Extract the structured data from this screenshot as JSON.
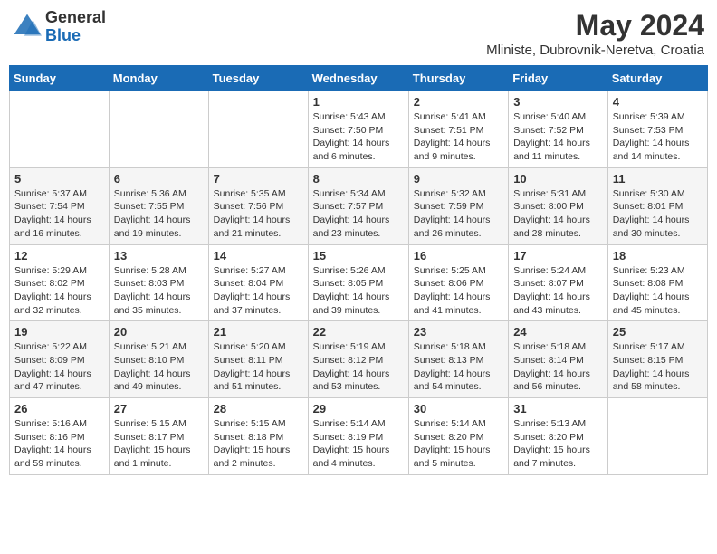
{
  "header": {
    "logo_general": "General",
    "logo_blue": "Blue",
    "month": "May 2024",
    "location": "Mliniste, Dubrovnik-Neretva, Croatia"
  },
  "days_of_week": [
    "Sunday",
    "Monday",
    "Tuesday",
    "Wednesday",
    "Thursday",
    "Friday",
    "Saturday"
  ],
  "weeks": [
    [
      {
        "day": "",
        "info": ""
      },
      {
        "day": "",
        "info": ""
      },
      {
        "day": "",
        "info": ""
      },
      {
        "day": "1",
        "info": "Sunrise: 5:43 AM\nSunset: 7:50 PM\nDaylight: 14 hours and 6 minutes."
      },
      {
        "day": "2",
        "info": "Sunrise: 5:41 AM\nSunset: 7:51 PM\nDaylight: 14 hours and 9 minutes."
      },
      {
        "day": "3",
        "info": "Sunrise: 5:40 AM\nSunset: 7:52 PM\nDaylight: 14 hours and 11 minutes."
      },
      {
        "day": "4",
        "info": "Sunrise: 5:39 AM\nSunset: 7:53 PM\nDaylight: 14 hours and 14 minutes."
      }
    ],
    [
      {
        "day": "5",
        "info": "Sunrise: 5:37 AM\nSunset: 7:54 PM\nDaylight: 14 hours and 16 minutes."
      },
      {
        "day": "6",
        "info": "Sunrise: 5:36 AM\nSunset: 7:55 PM\nDaylight: 14 hours and 19 minutes."
      },
      {
        "day": "7",
        "info": "Sunrise: 5:35 AM\nSunset: 7:56 PM\nDaylight: 14 hours and 21 minutes."
      },
      {
        "day": "8",
        "info": "Sunrise: 5:34 AM\nSunset: 7:57 PM\nDaylight: 14 hours and 23 minutes."
      },
      {
        "day": "9",
        "info": "Sunrise: 5:32 AM\nSunset: 7:59 PM\nDaylight: 14 hours and 26 minutes."
      },
      {
        "day": "10",
        "info": "Sunrise: 5:31 AM\nSunset: 8:00 PM\nDaylight: 14 hours and 28 minutes."
      },
      {
        "day": "11",
        "info": "Sunrise: 5:30 AM\nSunset: 8:01 PM\nDaylight: 14 hours and 30 minutes."
      }
    ],
    [
      {
        "day": "12",
        "info": "Sunrise: 5:29 AM\nSunset: 8:02 PM\nDaylight: 14 hours and 32 minutes."
      },
      {
        "day": "13",
        "info": "Sunrise: 5:28 AM\nSunset: 8:03 PM\nDaylight: 14 hours and 35 minutes."
      },
      {
        "day": "14",
        "info": "Sunrise: 5:27 AM\nSunset: 8:04 PM\nDaylight: 14 hours and 37 minutes."
      },
      {
        "day": "15",
        "info": "Sunrise: 5:26 AM\nSunset: 8:05 PM\nDaylight: 14 hours and 39 minutes."
      },
      {
        "day": "16",
        "info": "Sunrise: 5:25 AM\nSunset: 8:06 PM\nDaylight: 14 hours and 41 minutes."
      },
      {
        "day": "17",
        "info": "Sunrise: 5:24 AM\nSunset: 8:07 PM\nDaylight: 14 hours and 43 minutes."
      },
      {
        "day": "18",
        "info": "Sunrise: 5:23 AM\nSunset: 8:08 PM\nDaylight: 14 hours and 45 minutes."
      }
    ],
    [
      {
        "day": "19",
        "info": "Sunrise: 5:22 AM\nSunset: 8:09 PM\nDaylight: 14 hours and 47 minutes."
      },
      {
        "day": "20",
        "info": "Sunrise: 5:21 AM\nSunset: 8:10 PM\nDaylight: 14 hours and 49 minutes."
      },
      {
        "day": "21",
        "info": "Sunrise: 5:20 AM\nSunset: 8:11 PM\nDaylight: 14 hours and 51 minutes."
      },
      {
        "day": "22",
        "info": "Sunrise: 5:19 AM\nSunset: 8:12 PM\nDaylight: 14 hours and 53 minutes."
      },
      {
        "day": "23",
        "info": "Sunrise: 5:18 AM\nSunset: 8:13 PM\nDaylight: 14 hours and 54 minutes."
      },
      {
        "day": "24",
        "info": "Sunrise: 5:18 AM\nSunset: 8:14 PM\nDaylight: 14 hours and 56 minutes."
      },
      {
        "day": "25",
        "info": "Sunrise: 5:17 AM\nSunset: 8:15 PM\nDaylight: 14 hours and 58 minutes."
      }
    ],
    [
      {
        "day": "26",
        "info": "Sunrise: 5:16 AM\nSunset: 8:16 PM\nDaylight: 14 hours and 59 minutes."
      },
      {
        "day": "27",
        "info": "Sunrise: 5:15 AM\nSunset: 8:17 PM\nDaylight: 15 hours and 1 minute."
      },
      {
        "day": "28",
        "info": "Sunrise: 5:15 AM\nSunset: 8:18 PM\nDaylight: 15 hours and 2 minutes."
      },
      {
        "day": "29",
        "info": "Sunrise: 5:14 AM\nSunset: 8:19 PM\nDaylight: 15 hours and 4 minutes."
      },
      {
        "day": "30",
        "info": "Sunrise: 5:14 AM\nSunset: 8:20 PM\nDaylight: 15 hours and 5 minutes."
      },
      {
        "day": "31",
        "info": "Sunrise: 5:13 AM\nSunset: 8:20 PM\nDaylight: 15 hours and 7 minutes."
      },
      {
        "day": "",
        "info": ""
      }
    ]
  ]
}
